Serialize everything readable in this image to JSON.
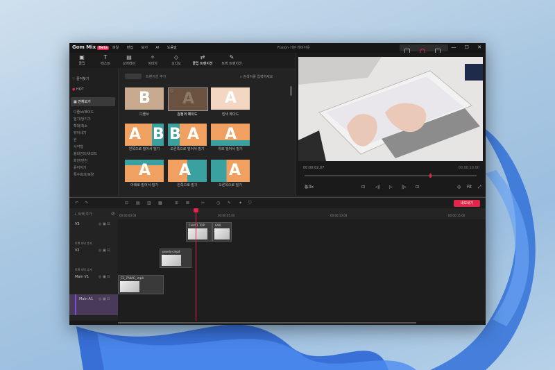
{
  "app": {
    "logo": "Gom Mix",
    "badge": "Beta",
    "doc_title": "Fusion 기본 레이아웃",
    "menus": [
      "파일",
      "편집",
      "보기",
      "AI",
      "도움말"
    ],
    "window_controls": [
      "—",
      "☐",
      "✕"
    ]
  },
  "ribbon": {
    "tabs": [
      {
        "icon": "▣",
        "label": "클립"
      },
      {
        "icon": "T",
        "label": "텍스트"
      },
      {
        "icon": "▤",
        "label": "오버레이"
      },
      {
        "icon": "✧",
        "label": "이미지"
      },
      {
        "icon": "◇",
        "label": "오디오"
      },
      {
        "icon": "⇄",
        "label": "클립 트랜지션"
      },
      {
        "icon": "✎",
        "label": "트랙 트랜지션"
      }
    ],
    "active_index": 5
  },
  "sidebar": {
    "favorites": "즐겨찾기",
    "hot": "HOT",
    "selected": "전체보기",
    "items": [
      "디졸브/페이드",
      "밀기/당기기",
      "확대/축소",
      "닦아내기",
      "원",
      "사각형",
      "블라인드/바코드",
      "회전/반전",
      "흩어지기",
      "특수효과/모양"
    ]
  },
  "transitions": {
    "toggle_label": "트랜지션 추가",
    "search_placeholder": "검색어를 입력하세요",
    "thumbs": [
      {
        "label": "디졸브"
      },
      {
        "label": "검정의 페이드"
      },
      {
        "label": "흰색 페이드"
      },
      {
        "label": "왼쪽으로 밀어서 밀기"
      },
      {
        "label": "오른쪽으로 밀어서 밀기"
      },
      {
        "label": "위로 밀어서 밀기"
      },
      {
        "label": "아래로 밀어서 밀기"
      },
      {
        "label": "왼쪽으로 밀기"
      },
      {
        "label": "오른쪽으로 밀기"
      }
    ]
  },
  "preview": {
    "time_current": "00:00:02.07",
    "time_total": "00:00:10.00",
    "speed": "1.0x",
    "zoom": "Fit"
  },
  "timeline": {
    "export_label": "내보내기",
    "add_track": "트랙 추가",
    "ruler": [
      "00:00:00.00",
      "00:00:05.00",
      "00:00:10.00",
      "00:00:15.00",
      "00:00:20.00"
    ],
    "tracks": [
      {
        "name": "V3",
        "sub": "트랙 자막 추가"
      },
      {
        "name": "V2",
        "sub": "트랙 자막 추가"
      },
      {
        "name": "Main V1",
        "sub": ""
      },
      {
        "name": "Main A1",
        "sub": ""
      }
    ],
    "clips": [
      {
        "label": "CHUST TOP"
      },
      {
        "label": "G90"
      },
      {
        "label": "pexels-cmp4"
      },
      {
        "label": "C1_7A0AC_.mp4"
      }
    ],
    "playhead_fraction": 0.21
  },
  "colors": {
    "accent": "#e0264b",
    "panel": "#232323",
    "audio": "#4a3a5a"
  }
}
